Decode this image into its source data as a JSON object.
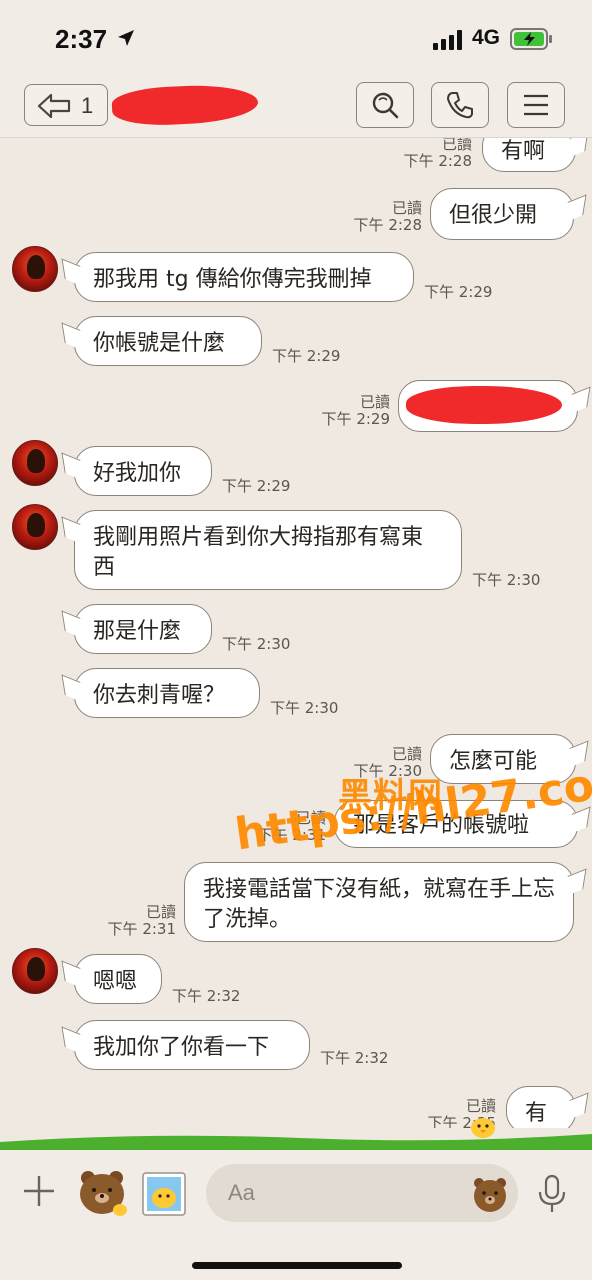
{
  "status_bar": {
    "time": "2:37",
    "network": "4G"
  },
  "header": {
    "back_count": "1"
  },
  "messages": [
    {
      "dir": "out",
      "text": "有啊",
      "read": "已讀",
      "time": "下午 2:28"
    },
    {
      "dir": "out",
      "text": "但很少開",
      "read": "已讀",
      "time": "下午 2:28"
    },
    {
      "dir": "in",
      "text": "那我用 tg 傳給你傳完我刪掉",
      "time": "下午 2:29"
    },
    {
      "dir": "in",
      "text": "你帳號是什麼",
      "time": "下午 2:29"
    },
    {
      "dir": "out",
      "text": "",
      "read": "已讀",
      "time": "下午 2:29"
    },
    {
      "dir": "in",
      "text": "好我加你",
      "time": "下午 2:29"
    },
    {
      "dir": "in",
      "text": "我剛用照片看到你大拇指那有寫東西",
      "time": "下午 2:30"
    },
    {
      "dir": "in",
      "text": "那是什麼",
      "time": "下午 2:30"
    },
    {
      "dir": "in",
      "text": "你去刺青喔？",
      "time": "下午 2:30"
    },
    {
      "dir": "out",
      "text": "怎麼可能",
      "read": "已讀",
      "time": "下午 2:30"
    },
    {
      "dir": "out",
      "text": "那是客戶的帳號啦",
      "read": "已讀",
      "time": "下午 2:31"
    },
    {
      "dir": "out",
      "text": "我接電話當下沒有紙，就寫在手上忘了洗掉。",
      "read": "已讀",
      "time": "下午 2:31"
    },
    {
      "dir": "in",
      "text": "嗯嗯",
      "time": "下午 2:32"
    },
    {
      "dir": "in",
      "text": "我加你了你看一下",
      "time": "下午 2:32"
    },
    {
      "dir": "out",
      "text": "有",
      "read": "已讀",
      "time": "下午 2:35"
    }
  ],
  "watermark": {
    "brand": "黑料网",
    "url": "https://hl27.co"
  },
  "input": {
    "placeholder": "Aa"
  },
  "colors": {
    "background": "#efe9e2",
    "bubble": "#ffffff",
    "redaction": "#f02a2a",
    "watermark": "#ff8a00"
  }
}
